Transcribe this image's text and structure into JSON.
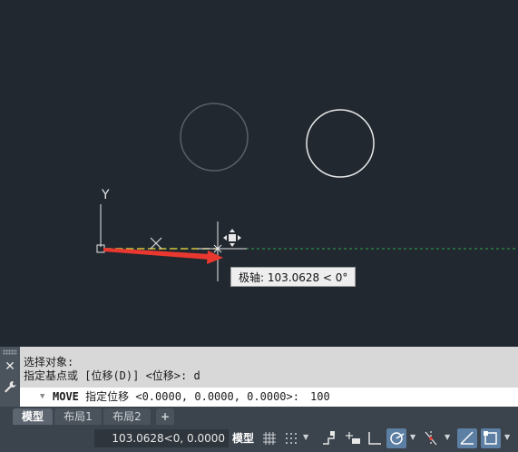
{
  "canvas": {
    "axis_label": "Y",
    "tooltip": "极轴: 103.0628 < 0°"
  },
  "command": {
    "history": [
      "选择对象:",
      "指定基点或 [位移(D)] <位移>:  d"
    ],
    "command_name": "MOVE",
    "prompt_text": " 指定位移 <0.0000, 0.0000, 0.0000>:",
    "input_value": "100"
  },
  "tabs": [
    {
      "label": "模型",
      "active": true
    },
    {
      "label": "布局1",
      "active": false
    },
    {
      "label": "布局2",
      "active": false
    }
  ],
  "add_tab_label": "+",
  "status": {
    "coordinates": "103.0628<0, 0.0000",
    "model_label": "模型"
  },
  "colors": {
    "canvas_bg": "#212830",
    "annotation_arrow": "#e8382f",
    "polar_track": "#2fa84a",
    "active_toggle": "#5c7fa3"
  },
  "icons": {
    "status_bar": [
      "grid-icon",
      "snap-icon",
      "infer-constraints-icon",
      "dynamic-input-icon",
      "ortho-icon",
      "polar-tracking-icon",
      "object-snap-tracking-icon",
      "isometric-drafting-icon",
      "object-snap-icon"
    ]
  }
}
